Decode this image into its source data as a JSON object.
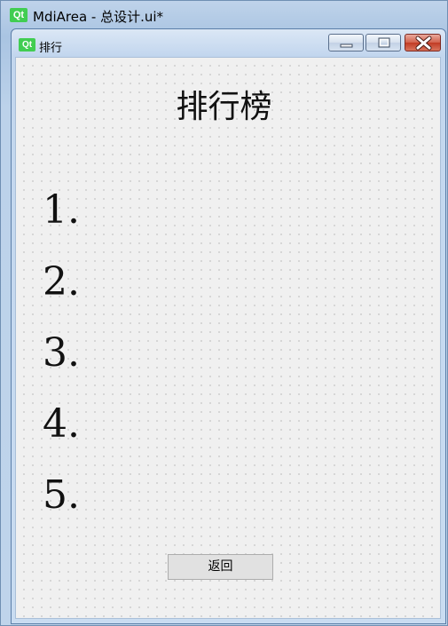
{
  "outer_window": {
    "title": "MdiArea - 总设计.ui*",
    "logo_text": "Qt"
  },
  "sub_window": {
    "title": "排行",
    "logo_text": "Qt"
  },
  "leaderboard": {
    "heading": "排行榜",
    "ranks": [
      "1.",
      "2.",
      "3.",
      "4.",
      "5."
    ]
  },
  "back_button": {
    "label": "返回"
  },
  "colors": {
    "qt_green": "#41cd52",
    "canvas_bg": "#f0f0f0",
    "close_red": "#c13b24"
  }
}
